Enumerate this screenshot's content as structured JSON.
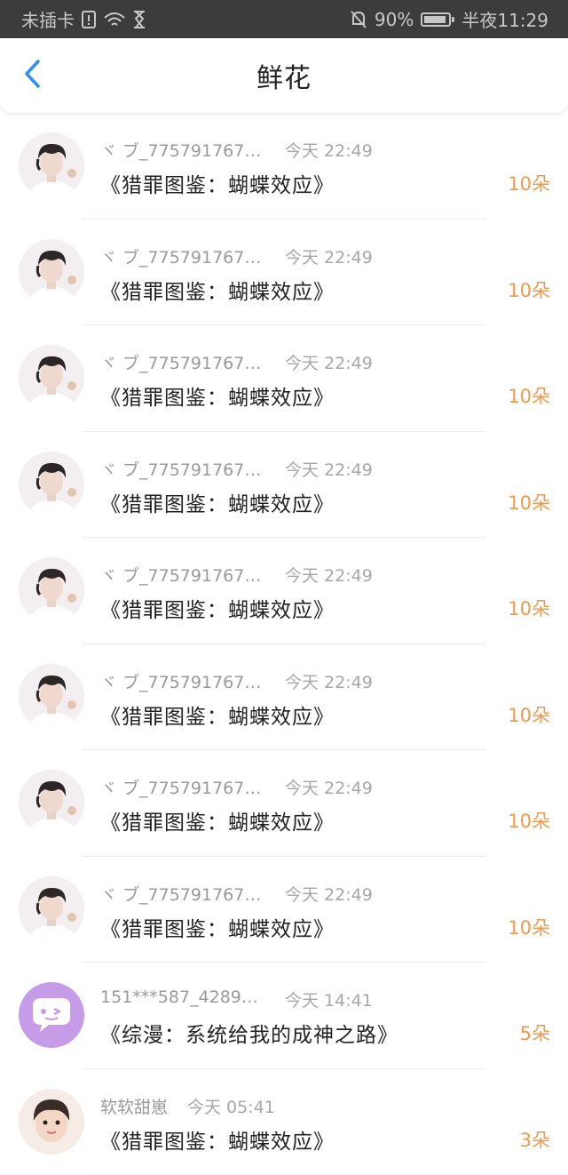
{
  "status_bar": {
    "carrier": "未插卡",
    "battery_percent": "90%",
    "battery_level": 0.9,
    "time": "半夜11:29",
    "icons": [
      "sim-alert-icon",
      "wifi-icon",
      "hourglass-icon",
      "bell-muted-icon",
      "battery-icon"
    ]
  },
  "header": {
    "title": "鲜花",
    "back_icon": "chevron-left-icon"
  },
  "colors": {
    "accent_blue": "#2f8ff0",
    "count_orange": "#f29a4b",
    "status_bar_bg": "#3c3c3c"
  },
  "records": [
    {
      "user": "ヾ ブ_7757917671...",
      "time": "今天 22:49",
      "book": "《猎罪图鉴：蝴蝶效应》",
      "count": "10朵",
      "avatar": "boy-avatar"
    },
    {
      "user": "ヾ ブ_7757917671...",
      "time": "今天 22:49",
      "book": "《猎罪图鉴：蝴蝶效应》",
      "count": "10朵",
      "avatar": "boy-avatar"
    },
    {
      "user": "ヾ ブ_7757917671...",
      "time": "今天 22:49",
      "book": "《猎罪图鉴：蝴蝶效应》",
      "count": "10朵",
      "avatar": "boy-avatar"
    },
    {
      "user": "ヾ ブ_7757917671...",
      "time": "今天 22:49",
      "book": "《猎罪图鉴：蝴蝶效应》",
      "count": "10朵",
      "avatar": "boy-avatar"
    },
    {
      "user": "ヾ ブ_7757917671...",
      "time": "今天 22:49",
      "book": "《猎罪图鉴：蝴蝶效应》",
      "count": "10朵",
      "avatar": "boy-avatar"
    },
    {
      "user": "ヾ ブ_7757917671...",
      "time": "今天 22:49",
      "book": "《猎罪图鉴：蝴蝶效应》",
      "count": "10朵",
      "avatar": "boy-avatar"
    },
    {
      "user": "ヾ ブ_7757917671...",
      "time": "今天 22:49",
      "book": "《猎罪图鉴：蝴蝶效应》",
      "count": "10朵",
      "avatar": "boy-avatar"
    },
    {
      "user": "ヾ ブ_7757917671...",
      "time": "今天 22:49",
      "book": "《猎罪图鉴：蝴蝶效应》",
      "count": "10朵",
      "avatar": "boy-avatar"
    },
    {
      "user": "151***587_42891...",
      "time": "今天 14:41",
      "book": "《综漫：系统给我的成神之路》",
      "count": "5朵",
      "avatar": "chat-bubble-avatar"
    },
    {
      "user": "软软甜崽",
      "time": "今天 05:41",
      "book": "《猎罪图鉴：蝴蝶效应》",
      "count": "3朵",
      "avatar": "girl-avatar"
    }
  ]
}
